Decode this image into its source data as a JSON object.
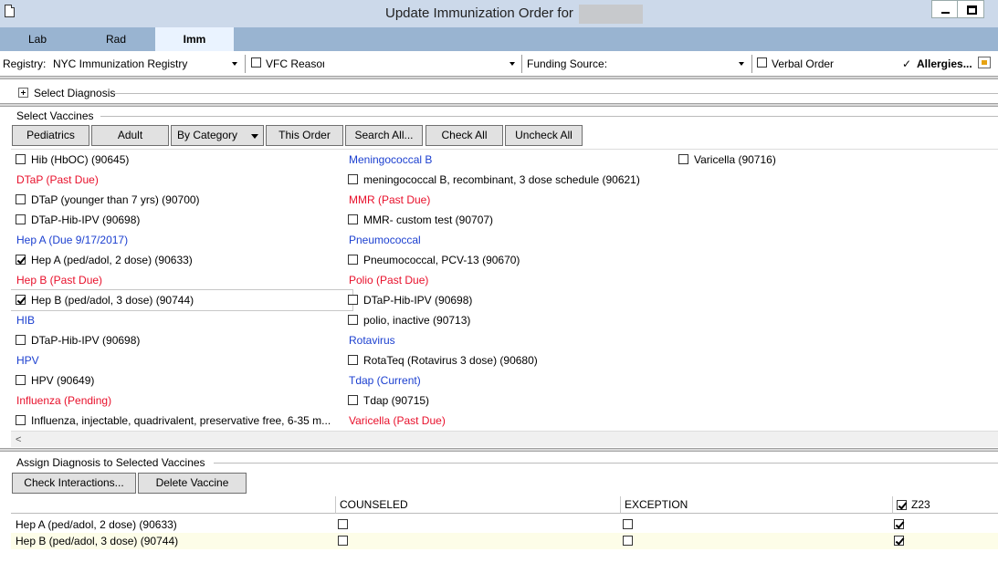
{
  "window": {
    "title": "Update Immunization Order for"
  },
  "tabs": [
    {
      "label": "Lab",
      "active": false
    },
    {
      "label": "Rad",
      "active": false
    },
    {
      "label": "Imm",
      "active": true
    }
  ],
  "toolbar": {
    "registry_label": "Registry:",
    "registry_value": "NYC Immunization Registry",
    "vfc_label": "VFC Reason",
    "funding_label": "Funding Source:",
    "funding_value": "",
    "verbal_label": "Verbal Order",
    "allergies_check": "✓",
    "allergies_label": "Allergies..."
  },
  "diagnosis": {
    "label": "Select Diagnosis"
  },
  "vaccines": {
    "group_label": "Select Vaccines",
    "buttons": {
      "pediatrics": "Pediatrics",
      "adult": "Adult",
      "by_category": "By Category",
      "this_order": "This Order",
      "search_all": "Search All...",
      "check_all": "Check All",
      "uncheck_all": "Uncheck All"
    },
    "columns": [
      [
        {
          "type": "item",
          "label": "Hib (HbOC) (90645)",
          "checked": false
        },
        {
          "type": "cat",
          "label": "DTaP (Past Due)",
          "color": "red"
        },
        {
          "type": "item",
          "label": "DTaP (younger than 7 yrs) (90700)",
          "checked": false
        },
        {
          "type": "item",
          "label": "DTaP-Hib-IPV (90698)",
          "checked": false
        },
        {
          "type": "cat",
          "label": "Hep A (Due 9/17/2017)",
          "color": "blue"
        },
        {
          "type": "item",
          "label": "Hep A (ped/adol, 2 dose) (90633)",
          "checked": true
        },
        {
          "type": "cat",
          "label": "Hep B (Past Due)",
          "color": "red"
        },
        {
          "type": "item",
          "label": "Hep B (ped/adol, 3 dose) (90744)",
          "checked": true,
          "selected": true
        },
        {
          "type": "cat",
          "label": "HIB",
          "color": "blue"
        },
        {
          "type": "item",
          "label": "DTaP-Hib-IPV (90698)",
          "checked": false
        },
        {
          "type": "cat",
          "label": "HPV",
          "color": "blue"
        },
        {
          "type": "item",
          "label": "HPV (90649)",
          "checked": false
        },
        {
          "type": "cat",
          "label": "Influenza (Pending)",
          "color": "red"
        },
        {
          "type": "item",
          "label": "Influenza, injectable, quadrivalent, preservative free, 6-35 m...",
          "checked": false
        }
      ],
      [
        {
          "type": "cat",
          "label": "Meningococcal B",
          "color": "blue"
        },
        {
          "type": "item",
          "label": "meningococcal B, recombinant,  3 dose schedule (90621)",
          "checked": false
        },
        {
          "type": "cat",
          "label": "MMR (Past Due)",
          "color": "red"
        },
        {
          "type": "item",
          "label": "MMR- custom test (90707)",
          "checked": false
        },
        {
          "type": "cat",
          "label": "Pneumococcal",
          "color": "blue"
        },
        {
          "type": "item",
          "label": "Pneumococcal, PCV-13 (90670)",
          "checked": false
        },
        {
          "type": "cat",
          "label": "Polio (Past Due)",
          "color": "red"
        },
        {
          "type": "item",
          "label": "DTaP-Hib-IPV (90698)",
          "checked": false
        },
        {
          "type": "item",
          "label": "polio, inactive (90713)",
          "checked": false
        },
        {
          "type": "cat",
          "label": "Rotavirus",
          "color": "blue"
        },
        {
          "type": "item",
          "label": "RotaTeq (Rotavirus 3 dose) (90680)",
          "checked": false
        },
        {
          "type": "cat",
          "label": "Tdap (Current)",
          "color": "blue"
        },
        {
          "type": "item",
          "label": "Tdap (90715)",
          "checked": false
        },
        {
          "type": "cat",
          "label": "Varicella (Past Due)",
          "color": "red"
        }
      ],
      [
        {
          "type": "item",
          "label": "Varicella (90716)",
          "checked": false
        }
      ]
    ]
  },
  "assign": {
    "group_label": "Assign Diagnosis to Selected Vaccines",
    "buttons": {
      "check_interactions": "Check Interactions...",
      "delete_vaccine": "Delete Vaccine"
    },
    "headers": {
      "vaccine": "",
      "counseled": "COUNSELED",
      "exception": "EXCEPTION",
      "z23": "Z23",
      "z23_checked": true
    },
    "rows": [
      {
        "vaccine": "Hep A (ped/adol, 2 dose) (90633)",
        "counseled": false,
        "exception": false,
        "z23": true
      },
      {
        "vaccine": "Hep B (ped/adol, 3 dose) (90744)",
        "counseled": false,
        "exception": false,
        "z23": true
      }
    ]
  },
  "colors": {
    "red": "#e8102b",
    "blue": "#1b3fd0",
    "tab_strip": "#99b4d1",
    "titlebar": "#ccd9ea",
    "active_tab": "#eaf3ff"
  }
}
